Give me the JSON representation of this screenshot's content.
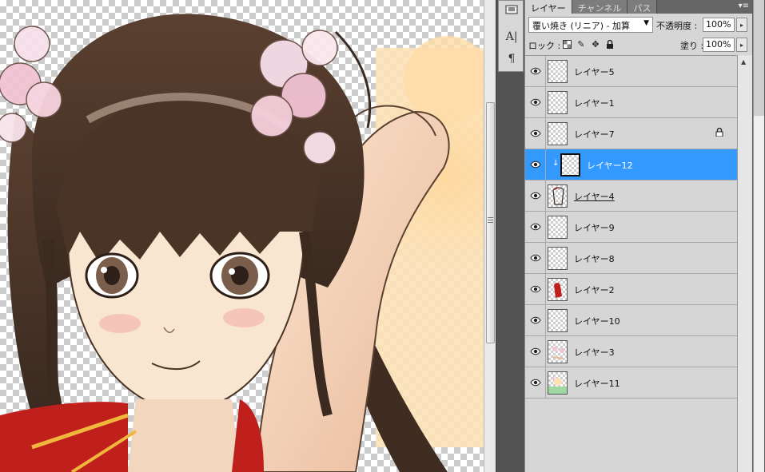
{
  "panel": {
    "tabs": [
      {
        "label": "レイヤー",
        "active": true
      },
      {
        "label": "チャンネル",
        "active": false
      },
      {
        "label": "パス",
        "active": false
      }
    ],
    "menu_icon": "panel-menu-icon",
    "blend_mode": "覆い焼き (リニア) - 加算",
    "opacity_label": "不透明度 :",
    "opacity_value": "100%",
    "lock_label": "ロック :",
    "fill_label": "塗り :",
    "fill_value": "100%"
  },
  "layers": [
    {
      "name": "レイヤー5",
      "visible": true,
      "selected": false,
      "locked": false,
      "clipped": false,
      "underline": false
    },
    {
      "name": "レイヤー1",
      "visible": true,
      "selected": false,
      "locked": false,
      "clipped": false,
      "underline": false
    },
    {
      "name": "レイヤー7",
      "visible": true,
      "selected": false,
      "locked": true,
      "clipped": false,
      "underline": false
    },
    {
      "name": "レイヤー12",
      "visible": true,
      "selected": true,
      "locked": false,
      "clipped": true,
      "underline": false
    },
    {
      "name": "レイヤー4",
      "visible": true,
      "selected": false,
      "locked": false,
      "clipped": false,
      "underline": true
    },
    {
      "name": "レイヤー9",
      "visible": true,
      "selected": false,
      "locked": false,
      "clipped": false,
      "underline": false
    },
    {
      "name": "レイヤー8",
      "visible": true,
      "selected": false,
      "locked": false,
      "clipped": false,
      "underline": false
    },
    {
      "name": "レイヤー2",
      "visible": true,
      "selected": false,
      "locked": false,
      "clipped": false,
      "underline": false
    },
    {
      "name": "レイヤー10",
      "visible": true,
      "selected": false,
      "locked": false,
      "clipped": false,
      "underline": false
    },
    {
      "name": "レイヤー3",
      "visible": true,
      "selected": false,
      "locked": false,
      "clipped": false,
      "underline": false
    },
    {
      "name": "レイヤー11",
      "visible": true,
      "selected": false,
      "locked": false,
      "clipped": false,
      "underline": false
    }
  ],
  "colors": {
    "selection": "#3399ff",
    "panel_bg": "#d6d6d6",
    "hair": "#4a3426",
    "skin": "#f7e3cc",
    "dress_red": "#c0201c"
  },
  "tools": [
    "character-tool-icon",
    "paragraph-tool-icon"
  ]
}
